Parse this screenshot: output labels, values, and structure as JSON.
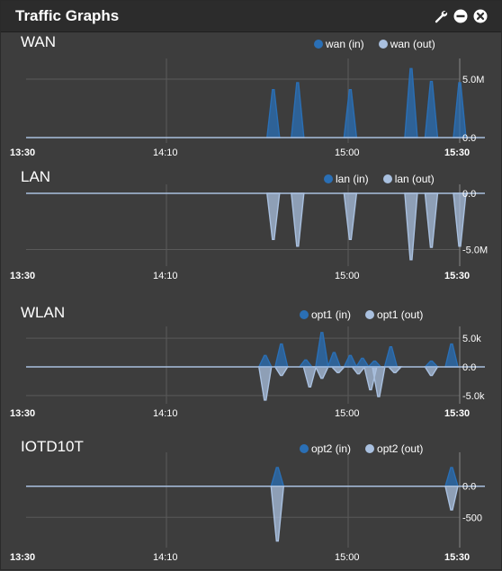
{
  "panel": {
    "title": "Traffic Graphs",
    "icons": [
      "wrench-icon",
      "minimize-icon",
      "close-icon"
    ]
  },
  "colors": {
    "in": "#2a6fb5",
    "out": "#a9c0df",
    "axis": "#a9c0df",
    "grid": "#5a5a5a"
  },
  "x_ticks": [
    "13:30",
    "14:10",
    "15:00",
    "15:30"
  ],
  "graphs": [
    {
      "name": "WAN",
      "legend_in": "wan (in)",
      "legend_out": "wan (out)",
      "y_tick_labels": [
        "5.0M",
        "0.0"
      ]
    },
    {
      "name": "LAN",
      "legend_in": "lan (in)",
      "legend_out": "lan (out)",
      "y_tick_labels": [
        "0.0",
        "-5.0M"
      ]
    },
    {
      "name": "WLAN",
      "legend_in": "opt1 (in)",
      "legend_out": "opt1 (out)",
      "y_tick_labels": [
        "5.0k",
        "0.0",
        "-5.0k"
      ]
    },
    {
      "name": "IOTD10T",
      "legend_in": "opt2 (in)",
      "legend_out": "opt2 (out)",
      "y_tick_labels": [
        "0.0",
        "-500"
      ]
    }
  ],
  "chart_data": [
    {
      "type": "area",
      "title": "WAN",
      "x": [
        "13:30",
        "14:10",
        "15:00",
        "15:30"
      ],
      "ylim": [
        0,
        6000000
      ],
      "series": [
        {
          "name": "wan (in)",
          "peaks": [
            [
              0.61,
              4100000
            ],
            [
              0.67,
              4700000
            ],
            [
              0.8,
              4100000
            ],
            [
              0.95,
              5900000
            ],
            [
              1.0,
              4800000
            ],
            [
              1.07,
              4700000
            ]
          ]
        },
        {
          "name": "wan (out)",
          "peaks": []
        }
      ]
    },
    {
      "type": "area",
      "title": "LAN",
      "x": [
        "13:30",
        "14:10",
        "15:00",
        "15:30"
      ],
      "ylim": [
        -6000000,
        0
      ],
      "series": [
        {
          "name": "lan (in)",
          "peaks": []
        },
        {
          "name": "lan (out)",
          "peaks": [
            [
              0.61,
              -4100000
            ],
            [
              0.67,
              -4700000
            ],
            [
              0.8,
              -4100000
            ],
            [
              0.95,
              -5900000
            ],
            [
              1.0,
              -4800000
            ],
            [
              1.07,
              -4700000
            ]
          ]
        }
      ]
    },
    {
      "type": "area",
      "title": "WLAN",
      "x": [
        "13:30",
        "14:10",
        "15:00",
        "15:30"
      ],
      "ylim": [
        -5500,
        5500
      ],
      "series": [
        {
          "name": "opt1 (in)",
          "peaks": [
            [
              0.59,
              2000
            ],
            [
              0.63,
              4000
            ],
            [
              0.69,
              1200
            ],
            [
              0.73,
              6000
            ],
            [
              0.76,
              2500
            ],
            [
              0.8,
              2000
            ],
            [
              0.83,
              1500
            ],
            [
              0.86,
              1000
            ],
            [
              0.9,
              3500
            ],
            [
              1.0,
              1000
            ],
            [
              1.05,
              4000
            ]
          ]
        },
        {
          "name": "opt1 (out)",
          "peaks": [
            [
              0.59,
              -5800
            ],
            [
              0.63,
              -1500
            ],
            [
              0.7,
              -3500
            ],
            [
              0.73,
              -2000
            ],
            [
              0.77,
              -1000
            ],
            [
              0.82,
              -1200
            ],
            [
              0.85,
              -4000
            ],
            [
              0.87,
              -5200
            ],
            [
              0.91,
              -1000
            ],
            [
              1.0,
              -1500
            ]
          ]
        }
      ]
    },
    {
      "type": "area",
      "title": "IOTD10T",
      "x": [
        "13:30",
        "14:10",
        "15:00",
        "15:30"
      ],
      "ylim": [
        -900,
        400
      ],
      "series": [
        {
          "name": "opt2 (in)",
          "peaks": [
            [
              0.62,
              300
            ],
            [
              1.05,
              300
            ]
          ]
        },
        {
          "name": "opt2 (out)",
          "peaks": [
            [
              0.62,
              -880
            ],
            [
              1.05,
              -380
            ]
          ]
        }
      ]
    }
  ]
}
